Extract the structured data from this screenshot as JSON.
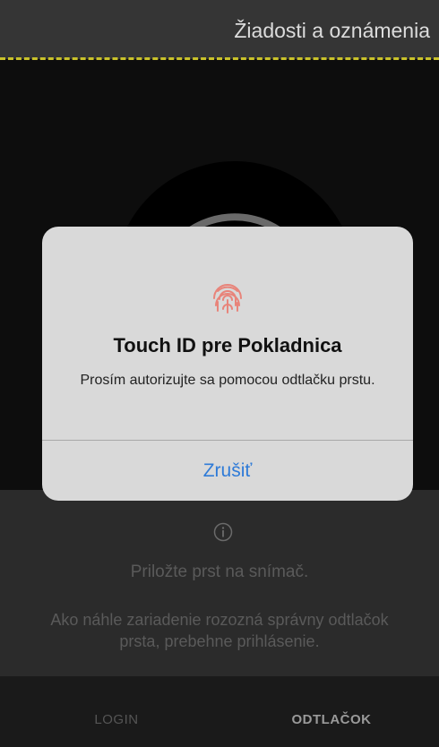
{
  "header": {
    "title": "Žiadosti a oznámenia"
  },
  "scanner": {
    "instruction": "Priložte prst na snímač.",
    "description": "Ako náhle zariadenie rozozná správny odtlačok prsta, prebehne prihlásenie."
  },
  "tabs": {
    "login": "LOGIN",
    "fingerprint": "ODTLAČOK"
  },
  "alert": {
    "title": "Touch ID pre Pokladnica",
    "message": "Prosím autorizujte sa pomocou odtlačku prstu.",
    "cancel": "Zrušiť"
  },
  "colors": {
    "accent_divider": "#c9c12a",
    "alert_button": "#2f7bd8",
    "fingerprint_icon": "#e8847a"
  },
  "icons": {
    "scanner": "fingerprint-icon",
    "info": "info-icon",
    "touch_id": "touch-id-icon"
  }
}
